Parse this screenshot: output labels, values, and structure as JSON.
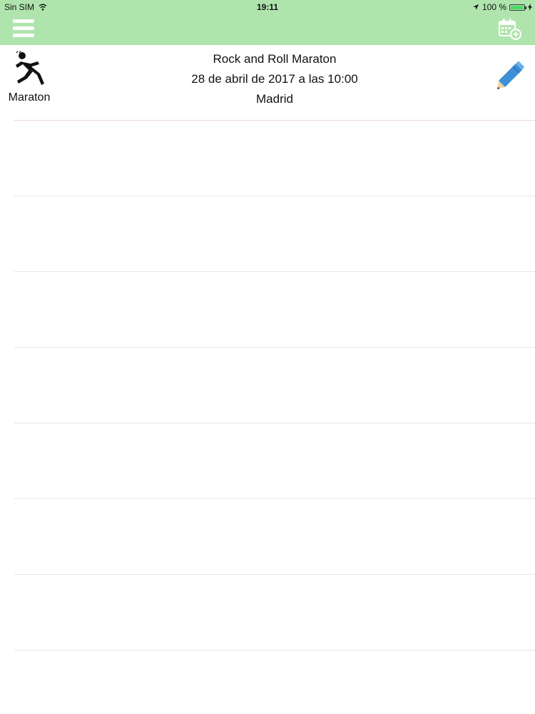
{
  "status_bar": {
    "carrier": "Sin SIM",
    "time": "19:11",
    "battery": "100 %",
    "icons": [
      "wifi-icon",
      "location-arrow-icon",
      "battery-icon",
      "charging-icon"
    ]
  },
  "navbar": {
    "menu_icon": "hamburger-menu-icon",
    "calendar_icon": "calendar-add-icon",
    "background_color": "#b0e4ad"
  },
  "event": {
    "type_label": "Maraton",
    "type_icon": "runner-icon",
    "title": "Rock and Roll Maraton",
    "datetime": "28 de abril de 2017 a las 10:00",
    "location": "Madrid",
    "edit_icon": "pencil-edit-icon"
  },
  "rows": [
    "",
    "",
    "",
    "",
    "",
    "",
    "",
    ""
  ]
}
